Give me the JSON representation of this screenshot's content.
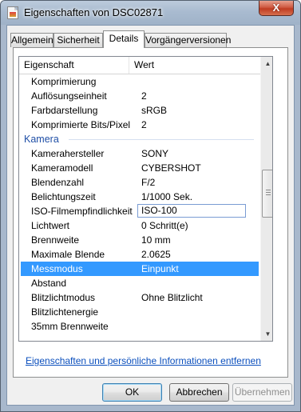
{
  "window": {
    "title": "Eigenschaften von DSC02871",
    "close_glyph": "X"
  },
  "tabs": [
    {
      "label": "Allgemein"
    },
    {
      "label": "Sicherheit"
    },
    {
      "label": "Details"
    },
    {
      "label": "Vorgängerversionen"
    }
  ],
  "list": {
    "header": {
      "property": "Eigenschaft",
      "value": "Wert"
    },
    "rows": [
      {
        "key": "Komprimierung",
        "value": ""
      },
      {
        "key": "Auflösungseinheit",
        "value": "2"
      },
      {
        "key": "Farbdarstellung",
        "value": "sRGB"
      },
      {
        "key": "Komprimierte Bits/Pixel",
        "value": "2"
      },
      {
        "key": "Kamera",
        "value": ""
      },
      {
        "key": "Kamerahersteller",
        "value": "SONY"
      },
      {
        "key": "Kameramodell",
        "value": "CYBERSHOT"
      },
      {
        "key": "Blendenzahl",
        "value": "F/2"
      },
      {
        "key": "Belichtungszeit",
        "value": "1/1000 Sek."
      },
      {
        "key": "ISO-Filmempfindlichkeit",
        "value": "ISO-100"
      },
      {
        "key": "Lichtwert",
        "value": "0 Schritt(e)"
      },
      {
        "key": "Brennweite",
        "value": "10 mm"
      },
      {
        "key": "Maximale Blende",
        "value": "2.0625"
      },
      {
        "key": "Messmodus",
        "value": "Einpunkt"
      },
      {
        "key": "Abstand",
        "value": ""
      },
      {
        "key": "Blitzlichtmodus",
        "value": "Ohne Blitzlicht"
      },
      {
        "key": "Blitzlichtenergie",
        "value": ""
      },
      {
        "key": "35mm Brennweite",
        "value": ""
      }
    ],
    "selected_index": 13,
    "editing_index": 9,
    "group_index": 4,
    "scroll_position_fraction": 0.42
  },
  "link_text": "Eigenschaften und persönliche Informationen entfernen",
  "buttons": {
    "ok": "OK",
    "cancel": "Abbrechen",
    "apply": "Übernehmen"
  },
  "colors": {
    "selection": "#3399ff",
    "link": "#0b4fbd",
    "group_header": "#1e4ea6"
  }
}
